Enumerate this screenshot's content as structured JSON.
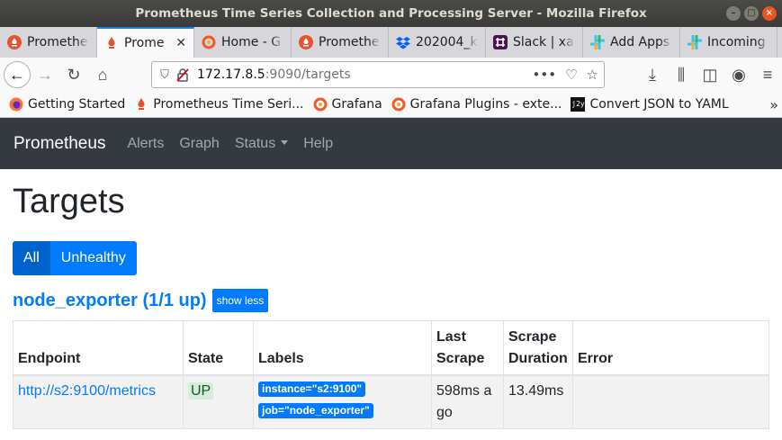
{
  "window": {
    "title": "Prometheus Time Series Collection and Processing Server - Mozilla Firefox"
  },
  "tabs": [
    {
      "label": "Promethe",
      "icon": "prometheus-icon",
      "active": false
    },
    {
      "label": "Prome",
      "icon": "prometheus-icon",
      "active": true
    },
    {
      "label": "Home - G",
      "icon": "grafana-icon",
      "active": false
    },
    {
      "label": "Promethe",
      "icon": "prometheus-icon",
      "active": false
    },
    {
      "label": "202004_k",
      "icon": "dropbox-icon",
      "active": false
    },
    {
      "label": "Slack | xa",
      "icon": "slack-icon",
      "active": false
    },
    {
      "label": "Add Apps",
      "icon": "slack-icon",
      "active": false
    },
    {
      "label": "Incoming",
      "icon": "slack-icon",
      "active": false
    }
  ],
  "url": {
    "host": "172.17.8.5",
    "path": ":9090/targets",
    "menu": "•••"
  },
  "bookmarks": [
    {
      "label": "Getting Started",
      "icon": "firefox-icon"
    },
    {
      "label": "Prometheus Time Seri...",
      "icon": "prometheus-icon"
    },
    {
      "label": "Grafana",
      "icon": "grafana-icon"
    },
    {
      "label": "Grafana Plugins - exte...",
      "icon": "grafana-icon"
    },
    {
      "label": "Convert JSON to YAML",
      "icon": "j2y-icon"
    }
  ],
  "j2y_text": "j2y",
  "prom": {
    "brand": "Prometheus",
    "links": [
      "Alerts",
      "Graph",
      "Status",
      "Help"
    ]
  },
  "page": {
    "title": "Targets",
    "filter_all": "All",
    "filter_unhealthy": "Unhealthy",
    "job_title": "node_exporter (1/1 up)",
    "show_less": "show less"
  },
  "table": {
    "headers": {
      "endpoint": "Endpoint",
      "state": "State",
      "labels": "Labels",
      "last_scrape_1": "Last",
      "last_scrape_2": "Scrape",
      "scrape_duration_1": "Scrape",
      "scrape_duration_2": "Duration",
      "error": "Error"
    },
    "rows": [
      {
        "endpoint": "http://s2:9100/metrics",
        "state": "UP",
        "label_instance": "instance=\"s2:9100\"",
        "label_job": "job=\"node_exporter\"",
        "last_scrape": "598ms a go",
        "scrape_duration": "13.49ms",
        "error": ""
      }
    ]
  },
  "colors": {
    "primary": "#007bff",
    "navbar": "#343a40",
    "up_bg": "#d4edda",
    "up_text": "#155724"
  }
}
